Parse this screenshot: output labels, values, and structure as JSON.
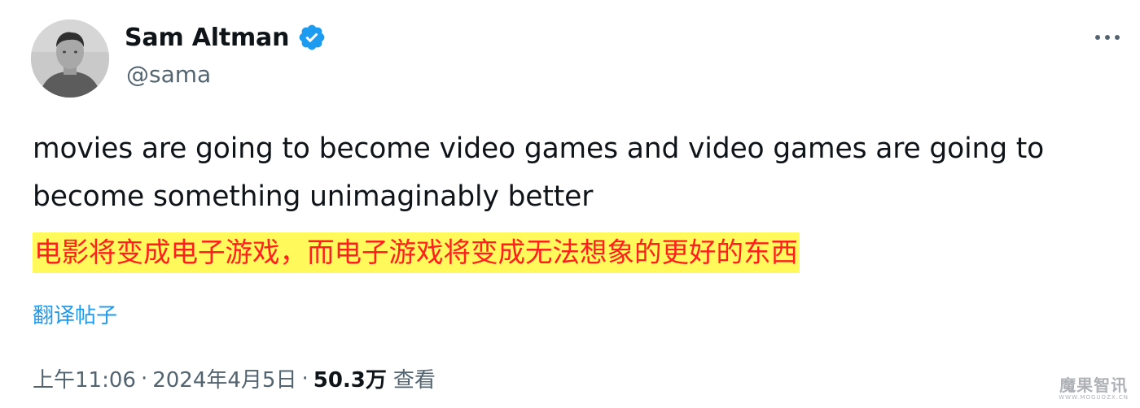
{
  "author": {
    "display_name": "Sam Altman",
    "handle": "@sama",
    "verified_icon": "verified-badge-icon",
    "avatar": "avatar"
  },
  "more_icon": "more-horizontal-icon",
  "tweet": {
    "text": "movies are going to become video games and video games are going to become something unimaginably better",
    "translation_overlay": "电影将变成电子游戏，而电子游戏将变成无法想象的更好的东西",
    "translate_link": "翻译帖子"
  },
  "meta": {
    "time": "上午11:06",
    "separator": "·",
    "date": "2024年4月5日",
    "views_count": "50.3万",
    "views_label": "查看"
  },
  "watermark": {
    "main": "魔果智讯",
    "sub": "WWW.MOGUOZX.CN"
  },
  "colors": {
    "link": "#1d9bf0",
    "secondary_text": "#536471",
    "verified": "#1d9bf0",
    "highlight_bg": "#fff95b",
    "highlight_text": "#ff1f1f"
  }
}
